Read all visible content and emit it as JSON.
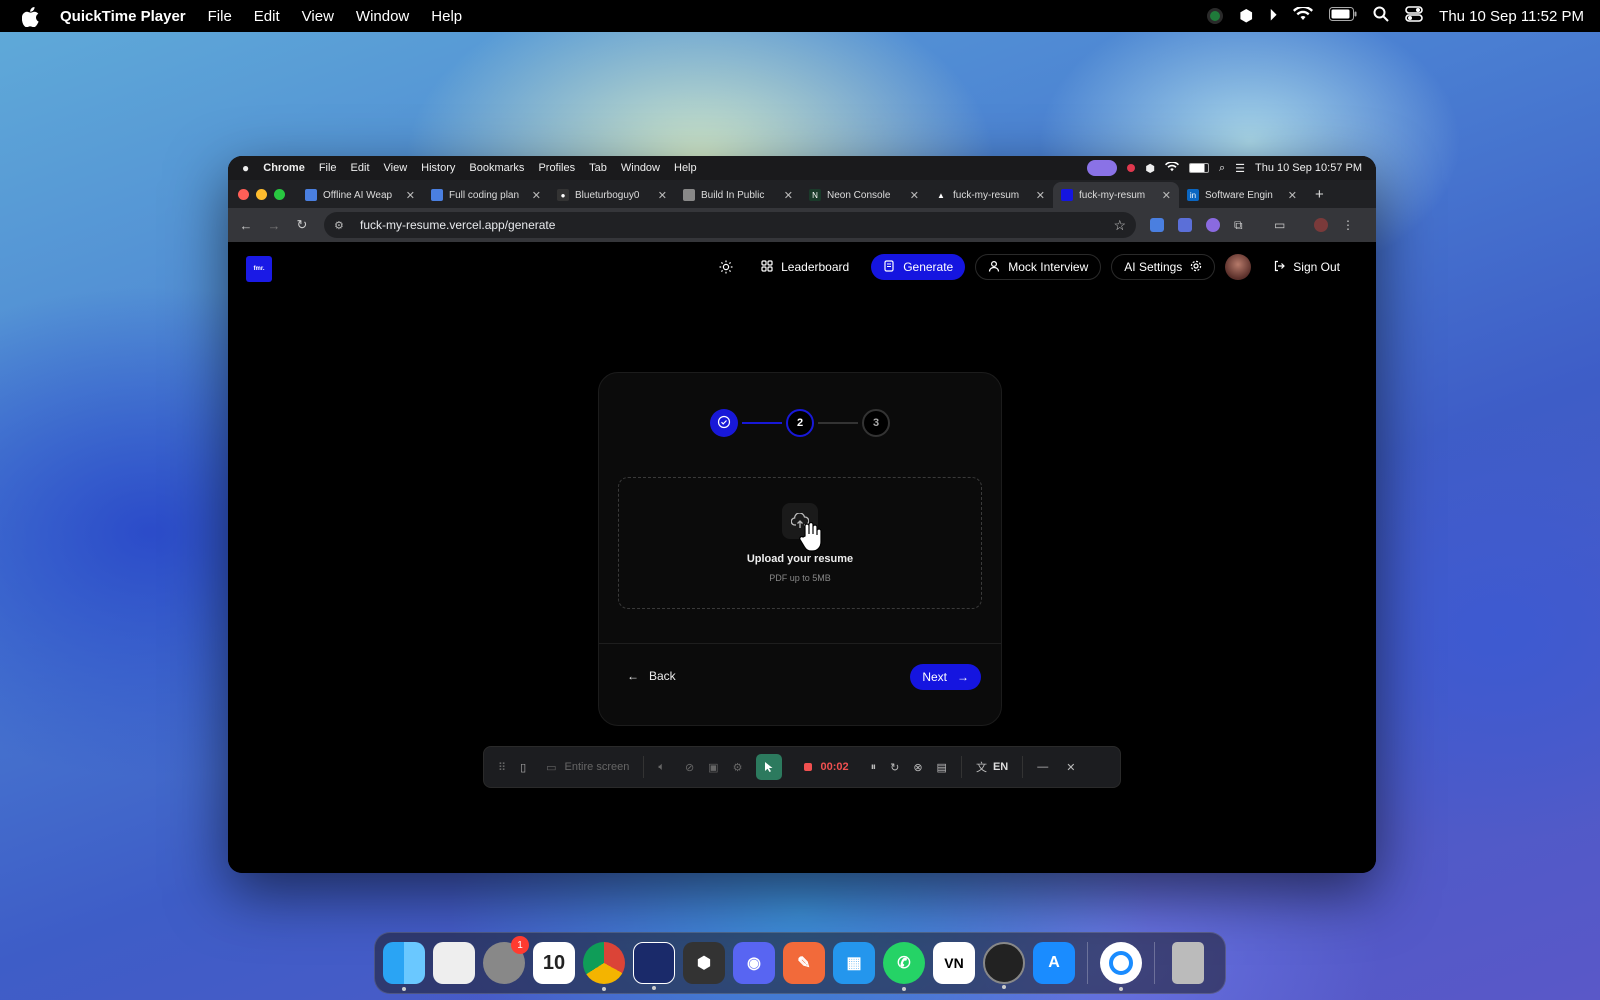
{
  "menubar": {
    "app": "QuickTime Player",
    "items": [
      "File",
      "Edit",
      "View",
      "Window",
      "Help"
    ],
    "clock": "Thu 10 Sep  11:52 PM"
  },
  "chrome_menubar": {
    "app": "Chrome",
    "items": [
      "File",
      "Edit",
      "View",
      "History",
      "Bookmarks",
      "Profiles",
      "Tab",
      "Window",
      "Help"
    ],
    "clock": "Thu 10 Sep  10:57 PM"
  },
  "tabs": [
    {
      "title": "Offline AI Weap",
      "color": "#4a7fe0",
      "glyph": ""
    },
    {
      "title": "Full coding plan",
      "color": "#4a7fe0",
      "glyph": ""
    },
    {
      "title": "Blueturboguy0",
      "color": "#333333",
      "glyph": "●"
    },
    {
      "title": "Build In Public",
      "color": "#888888",
      "glyph": ""
    },
    {
      "title": "Neon Console",
      "color": "#1a3a2a",
      "glyph": "N"
    },
    {
      "title": "fuck-my-resum",
      "color": "#202124",
      "glyph": "▲"
    },
    {
      "title": "fuck-my-resum",
      "color": "#1515e0",
      "glyph": "",
      "active": true
    },
    {
      "title": "Software Engin",
      "color": "#0a66c2",
      "glyph": "in"
    }
  ],
  "address": {
    "url": "fuck-my-resume.vercel.app/generate"
  },
  "site": {
    "logo_text": "fmr.",
    "nav": {
      "leaderboard": "Leaderboard",
      "generate": "Generate",
      "mock_interview": "Mock Interview",
      "ai_settings": "AI Settings",
      "sign_out": "Sign Out"
    },
    "accent": "#1515e0"
  },
  "wizard": {
    "steps": [
      {
        "label": "",
        "state": "done"
      },
      {
        "label": "2",
        "state": "current"
      },
      {
        "label": "3",
        "state": "todo"
      }
    ],
    "upload_title": "Upload your resume",
    "upload_sub": "PDF up to 5MB",
    "back_label": "Back",
    "next_label": "Next"
  },
  "recorder": {
    "source": "Entire screen",
    "time": "00:02",
    "lang": "EN"
  },
  "inner_dock": {
    "calendar_day": "10",
    "settings_badge": "1"
  },
  "dock": {
    "calendar_day": "10",
    "settings_badge": "1"
  }
}
